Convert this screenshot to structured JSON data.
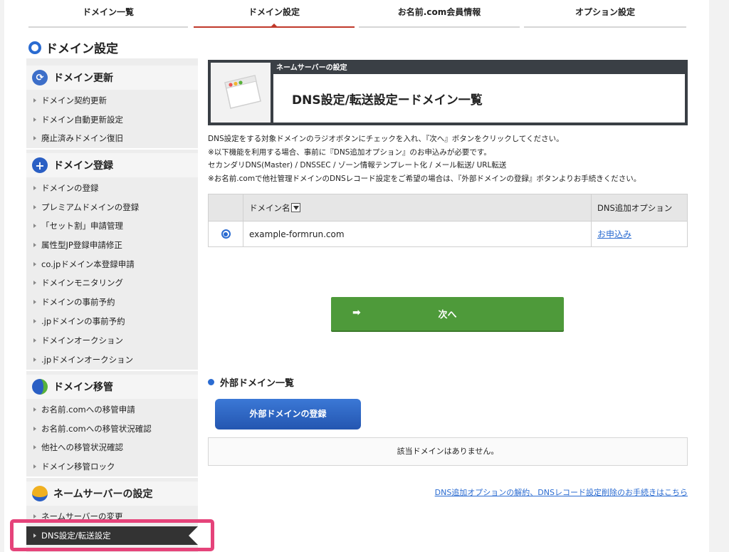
{
  "tabs": [
    {
      "label": "ドメイン一覧"
    },
    {
      "label": "ドメイン設定"
    },
    {
      "label": "お名前.com会員情報"
    },
    {
      "label": "オプション設定"
    }
  ],
  "section_title": "ドメイン設定",
  "sidebar": {
    "groups": [
      {
        "title": "ドメイン更新",
        "items": [
          "ドメイン契約更新",
          "ドメイン自動更新設定",
          "廃止済みドメイン復旧"
        ]
      },
      {
        "title": "ドメイン登録",
        "items": [
          "ドメインの登録",
          "プレミアムドメインの登録",
          "「セット割」申請管理",
          "属性型JP登録申請修正",
          "co.jpドメイン本登録申請",
          "ドメインモニタリング",
          "ドメインの事前予約",
          ".jpドメインの事前予約",
          "ドメインオークション",
          ".jpドメインオークション"
        ]
      },
      {
        "title": "ドメイン移管",
        "items": [
          "お名前.comへの移管申請",
          "お名前.comへの移管状況確認",
          "他社への移管状況確認",
          "ドメイン移管ロック"
        ]
      },
      {
        "title": "ネームサーバーの設定",
        "items": [
          "ネームサーバーの変更"
        ]
      }
    ],
    "active_item": "DNS設定/転送設定"
  },
  "header": {
    "label": "ネームサーバーの設定",
    "title": "DNS設定/転送設定ードメイン一覧"
  },
  "description": [
    "DNS設定をする対象ドメインのラジオボタンにチェックを入れ、『次へ』ボタンをクリックしてください。",
    "※以下機能を利用する場合、事前に『DNS追加オプション』のお申込みが必要です。",
    "セカンダリDNS(Master) / DNSSEC / ゾーン情報テンプレート化 / メール転送/ URL転送",
    "※お名前.comで他社管理ドメインのDNSレコード設定をご希望の場合は、『外部ドメインの登録』ボタンよりお手続きください。"
  ],
  "table": {
    "col_domain": "ドメイン名",
    "col_option": "DNS追加オプション",
    "rows": [
      {
        "domain": "example-formrun.com",
        "option": "お申込み"
      }
    ]
  },
  "next_button": "次へ",
  "external": {
    "title": "外部ドメイン一覧",
    "register_button": "外部ドメインの登録",
    "empty_message": "該当ドメインはありません。"
  },
  "footer_link": "DNS追加オプションの解約、DNSレコード設定削除のお手続きはこちら",
  "colors": {
    "accent_blue": "#2a6bd1",
    "active_tab": "#c0392b",
    "next_green": "#4e9a3a",
    "highlight": "#e5437a"
  }
}
